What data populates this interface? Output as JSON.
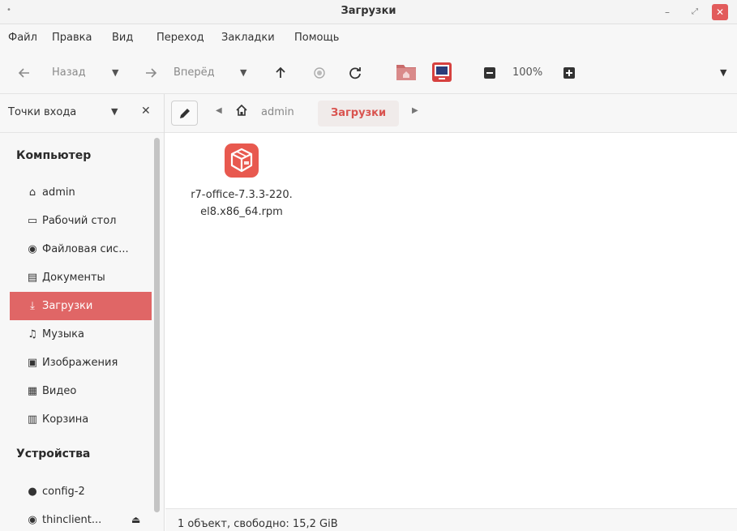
{
  "window": {
    "title": "Загрузки",
    "title_dot": "•",
    "min_glyph": "–",
    "max_glyph": "⤢",
    "close_glyph": "✕"
  },
  "menu": [
    "Файл",
    "Правка",
    "Вид",
    "Переход",
    "Закладки",
    "Помощь"
  ],
  "toolbar": {
    "back_label": "Назад",
    "forward_label": "Вперёд",
    "zoom": "100%"
  },
  "sidebar": {
    "header_label": "Точки входа",
    "close_glyph": "✕",
    "dropdown_glyph": "▼",
    "sections": [
      {
        "title": "Компьютер",
        "items": [
          {
            "label": "admin",
            "icon": "home-icon",
            "glyph": "⌂"
          },
          {
            "label": "Рабочий стол",
            "icon": "desktop-icon",
            "glyph": "▭"
          },
          {
            "label": "Файловая сис...",
            "icon": "disk-icon",
            "glyph": "◉"
          },
          {
            "label": "Документы",
            "icon": "documents-icon",
            "glyph": "▤"
          },
          {
            "label": "Загрузки",
            "icon": "downloads-icon",
            "glyph": "⤓",
            "active": true
          },
          {
            "label": "Музыка",
            "icon": "music-icon",
            "glyph": "♫"
          },
          {
            "label": "Изображения",
            "icon": "pictures-icon",
            "glyph": "▣"
          },
          {
            "label": "Видео",
            "icon": "video-icon",
            "glyph": "▦"
          },
          {
            "label": "Корзина",
            "icon": "trash-icon",
            "glyph": "▥"
          }
        ]
      },
      {
        "title": "Устройства",
        "items": [
          {
            "label": "config-2",
            "icon": "drive-icon",
            "glyph": "●"
          },
          {
            "label": "thinclient...",
            "icon": "disk-icon",
            "glyph": "◉",
            "eject": "⏏"
          }
        ]
      }
    ]
  },
  "breadcrumb": {
    "home_label": "admin",
    "current": "Загрузки"
  },
  "files": [
    {
      "name_line1": "r7-office-7.3.3-220.",
      "name_line2": "el8.x86_64.rpm",
      "icon": "rpm-package-icon"
    }
  ],
  "status": "1 объект, свободно: 15,2 GiB",
  "colors": {
    "accent": "#e06666",
    "active_crumb_text": "#d9534f",
    "package_icon": "#e8594f"
  }
}
